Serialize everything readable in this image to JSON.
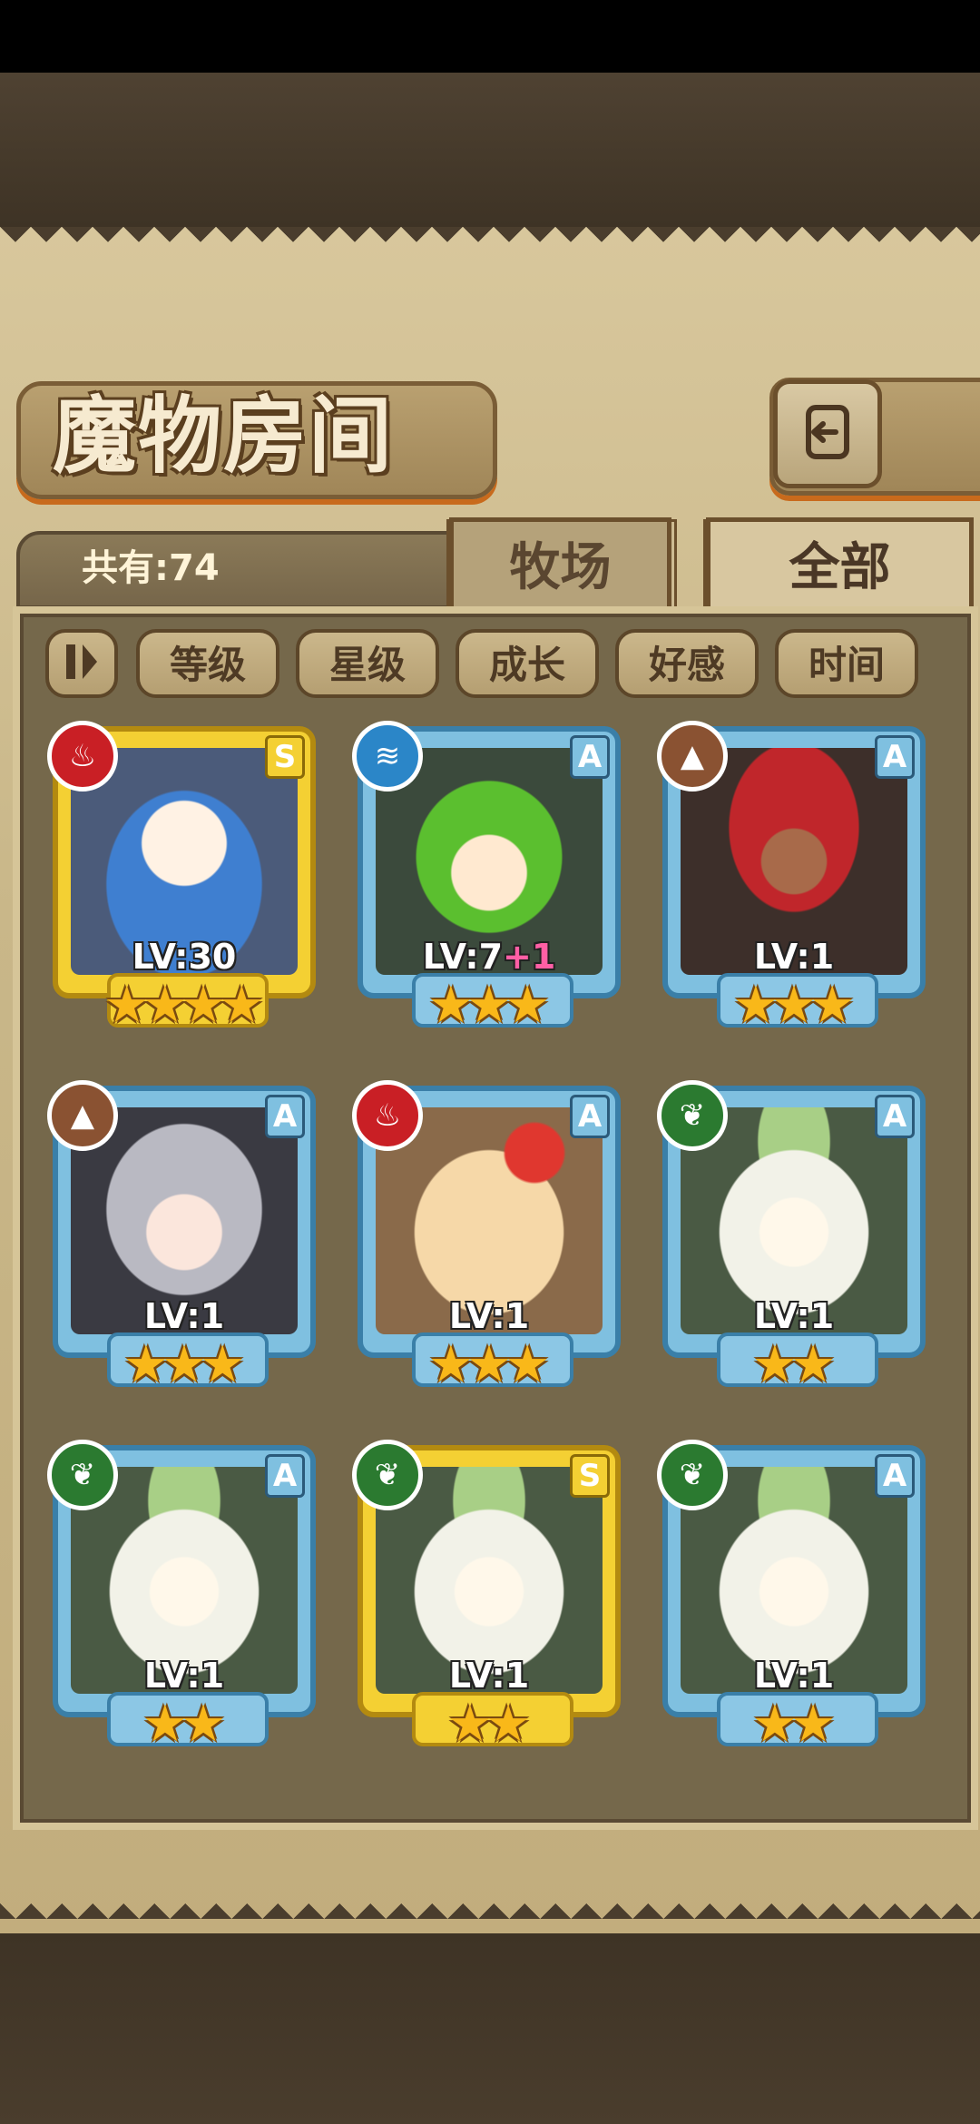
{
  "title": "魔物房间",
  "count_label": "共有:74",
  "tabs": [
    {
      "label": "牧场",
      "active": false
    },
    {
      "label": "全部",
      "active": true
    }
  ],
  "sort_buttons": [
    "等级",
    "星级",
    "成长",
    "好感",
    "时间"
  ],
  "cards": [
    {
      "rank": "S",
      "element": "fire",
      "level": "LV:30",
      "bonus": "",
      "stars": 4
    },
    {
      "rank": "A",
      "element": "water",
      "level": "LV:7",
      "bonus": "+1",
      "stars": 3
    },
    {
      "rank": "A",
      "element": "earth",
      "level": "LV:1",
      "bonus": "",
      "stars": 3
    },
    {
      "rank": "A",
      "element": "earth",
      "level": "LV:1",
      "bonus": "",
      "stars": 3
    },
    {
      "rank": "A",
      "element": "fire",
      "level": "LV:1",
      "bonus": "",
      "stars": 3
    },
    {
      "rank": "A",
      "element": "grass",
      "level": "LV:1",
      "bonus": "",
      "stars": 2
    },
    {
      "rank": "A",
      "element": "grass",
      "level": "LV:1",
      "bonus": "",
      "stars": 2
    },
    {
      "rank": "S",
      "element": "grass",
      "level": "LV:1",
      "bonus": "",
      "stars": 2
    },
    {
      "rank": "A",
      "element": "grass",
      "level": "LV:1",
      "bonus": "",
      "stars": 2
    }
  ],
  "colors": {
    "rank_a_frame": "#7fc0e0",
    "rank_s_frame": "#f4d033",
    "fire": "#c91f25",
    "water": "#2b86c8",
    "earth": "#8a5232",
    "grass": "#2b7a30",
    "star": "#f9b819"
  }
}
